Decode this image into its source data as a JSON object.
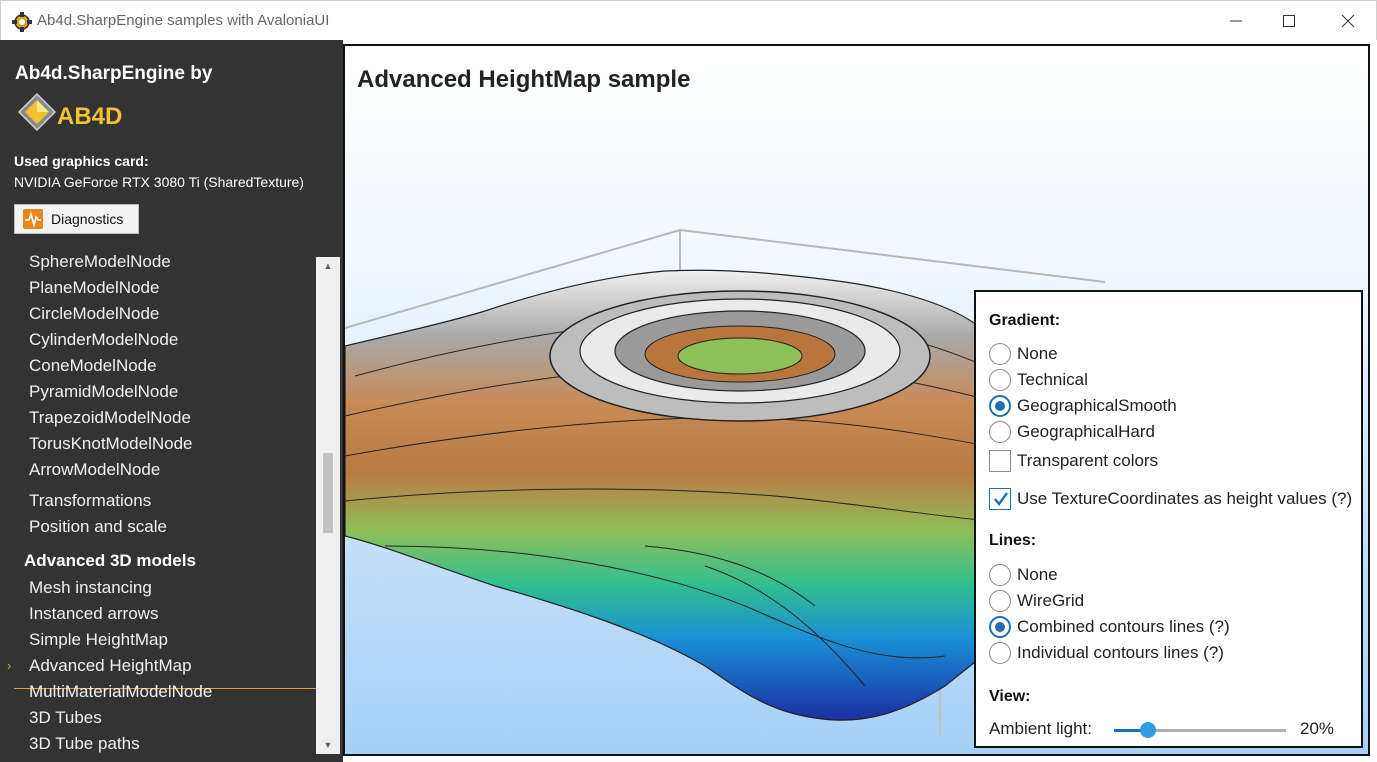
{
  "window": {
    "title": "Ab4d.SharpEngine samples with AvaloniaUI",
    "minimize_glyph": "—",
    "maximize_glyph": "☐",
    "close_glyph": "✕"
  },
  "sidebar": {
    "brand": "Ab4d.SharpEngine by",
    "logo_text": "AB4D",
    "graphics_card_label": "Used graphics card:",
    "graphics_card_value": "NVIDIA GeForce RTX 3080 Ti (SharedTexture)",
    "diagnostics_label": "Diagnostics",
    "nav": [
      {
        "label": "SphereModelNode",
        "type": "item"
      },
      {
        "label": "PlaneModelNode",
        "type": "item"
      },
      {
        "label": "CircleModelNode",
        "type": "item"
      },
      {
        "label": "CylinderModelNode",
        "type": "item"
      },
      {
        "label": "ConeModelNode",
        "type": "item"
      },
      {
        "label": "PyramidModelNode",
        "type": "item"
      },
      {
        "label": "TrapezoidModelNode",
        "type": "item"
      },
      {
        "label": "TorusKnotModelNode",
        "type": "item"
      },
      {
        "label": "ArrowModelNode",
        "type": "item"
      },
      {
        "label": "Transformations",
        "type": "item"
      },
      {
        "label": "Position and scale",
        "type": "item"
      },
      {
        "label": "Advanced 3D models",
        "type": "header"
      },
      {
        "label": "Mesh instancing",
        "type": "item"
      },
      {
        "label": "Instanced arrows",
        "type": "item"
      },
      {
        "label": "Simple HeightMap",
        "type": "item"
      },
      {
        "label": "Advanced HeightMap",
        "type": "item",
        "selected": true
      },
      {
        "label": "MultiMaterialModelNode",
        "type": "item"
      },
      {
        "label": "3D Tubes",
        "type": "item"
      },
      {
        "label": "3D Tube paths",
        "type": "item"
      }
    ],
    "selected_marker": "›",
    "scroll_up_glyph": "▲",
    "scroll_down_glyph": "▼"
  },
  "main": {
    "title": "Advanced HeightMap sample"
  },
  "options": {
    "gradient_header": "Gradient:",
    "gradient_options": [
      {
        "label": "None",
        "checked": false
      },
      {
        "label": "Technical",
        "checked": false
      },
      {
        "label": "GeographicalSmooth",
        "checked": true
      },
      {
        "label": "GeographicalHard",
        "checked": false
      }
    ],
    "transparent_colors": {
      "label": "Transparent colors",
      "checked": false
    },
    "use_texture_coords": {
      "label": "Use TextureCoordinates as height values (?)",
      "checked": true
    },
    "lines_header": "Lines:",
    "lines_options": [
      {
        "label": "None",
        "checked": false
      },
      {
        "label": "WireGrid",
        "checked": false
      },
      {
        "label": "Combined contours lines (?)",
        "checked": true
      },
      {
        "label": "Individual contours lines (?)",
        "checked": false
      }
    ],
    "view_header": "View:",
    "ambient_label": "Ambient light:",
    "ambient_value": "20%",
    "ambient_fraction": 0.2
  },
  "colors": {
    "sidebar_bg": "#333333",
    "accent": "#e0a12c",
    "radio_blue": "#1f6fb0"
  }
}
